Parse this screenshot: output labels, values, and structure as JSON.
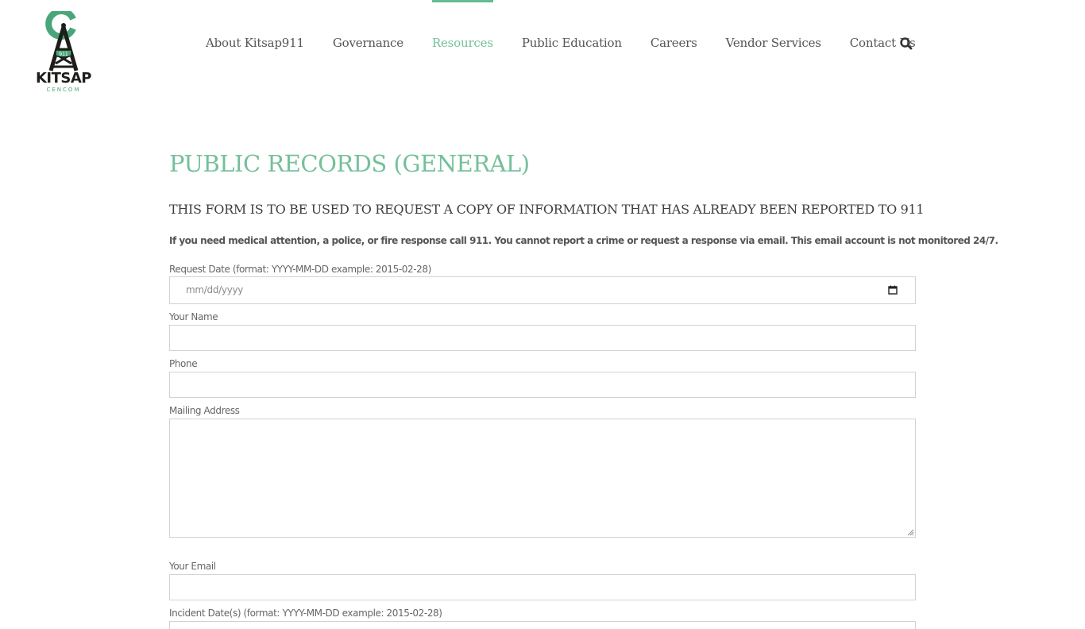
{
  "logo": {
    "badge_text": "911",
    "name": "KITSAP",
    "subname": "CENCOM",
    "colors": {
      "green": "#4aa67a",
      "dark": "#1d1d1b"
    }
  },
  "nav": {
    "items": [
      {
        "label": "About Kitsap911",
        "active": false
      },
      {
        "label": "Governance",
        "active": false
      },
      {
        "label": "Resources",
        "active": true
      },
      {
        "label": "Public Education",
        "active": false
      },
      {
        "label": "Careers",
        "active": false
      },
      {
        "label": "Vendor Services",
        "active": false
      },
      {
        "label": "Contact Us",
        "active": false
      }
    ],
    "search_icon": "search-icon",
    "accent_color": "#74c09a"
  },
  "page": {
    "title": "PUBLIC RECORDS (GENERAL)",
    "subtitle": "THIS FORM IS TO BE USED TO REQUEST A COPY OF INFORMATION THAT HAS ALREADY BEEN REPORTED TO 911",
    "notice": "If you need medical attention, a police, or fire response call 911. You cannot report a crime or request a response via email. This email account is not monitored 24/7."
  },
  "form": {
    "request_date": {
      "label": "Request Date (format: YYYY-MM-DD example: 2015-02-28)",
      "placeholder": "mm/dd/yyyy",
      "value": ""
    },
    "name": {
      "label": "Your Name",
      "value": ""
    },
    "phone": {
      "label": "Phone",
      "value": ""
    },
    "mailing_address": {
      "label": "Mailing Address",
      "value": ""
    },
    "email": {
      "label": "Your Email",
      "value": ""
    },
    "incident_dates": {
      "label": "Incident Date(s) (format: YYYY-MM-DD example: 2015-02-28)",
      "value": ""
    }
  }
}
